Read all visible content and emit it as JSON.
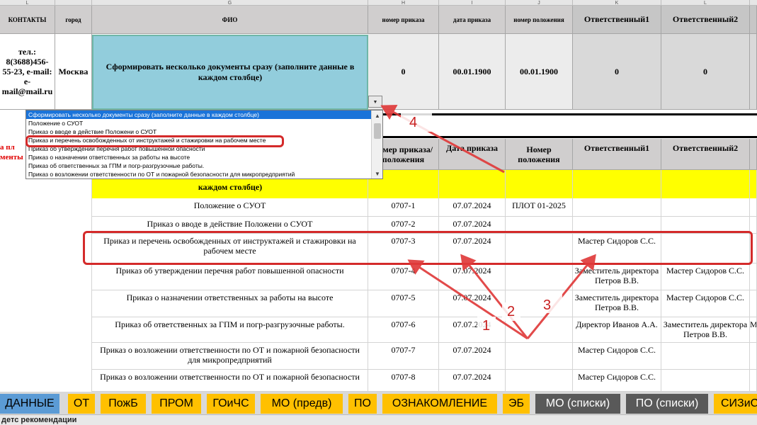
{
  "column_letters": [
    "L",
    "G",
    "H",
    "I",
    "J",
    "K",
    "L"
  ],
  "top_header": {
    "contacts": "КОНТАКТЫ",
    "city": "город",
    "fio": "ФИО",
    "order_number": "номер приказа",
    "order_date": "дата приказа",
    "regulation_number": "номер положения",
    "responsible1": "Ответственный1",
    "responsible2": "Ответственный2"
  },
  "top_row": {
    "contacts": "тел.: 8(3688)456-55-23, e-mail: e-mail@mail.ru",
    "city": "Москва",
    "fio_value": "Сформировать несколько документы сразу (заполните данные в каждом столбце)",
    "order_number": "0",
    "order_date": "00.01.1900",
    "regulation_number": "00.01.1900",
    "responsible1": "0",
    "responsible2": "0"
  },
  "side_text": {
    "line1": "а пл",
    "line2": "менты"
  },
  "dropdown": {
    "items": [
      "Сформировать несколько документы сразу (заполните данные в каждом столбце)",
      "Положение о СУОТ",
      "Приказ о вводе в действие Положени о СУОТ",
      "Приказ и перечень освобожденных от инструктажей и стажировки на рабочем месте",
      "Приказ об утверждении перечня работ повышенной опасности",
      "Приказ о назначении ответственных за работы на высоте",
      "Приказ об ответственных за ГПМ и погр-разгрузочные работы.",
      "Приказ о возложении ответственности по ОТ и пожарной безопасности для микропредприятий"
    ],
    "selected_index": 0,
    "highlighted_index": 3,
    "scroll_up": "▲",
    "scroll_down": "▼",
    "arrow": "▼"
  },
  "lower_header": {
    "order_regulation_number": "номер приказа/ положения",
    "order_date": "Дата приказа",
    "regulation_number": "Номер положения",
    "responsible1": "Ответственный1",
    "responsible2": "Ответственный2"
  },
  "yellow_row_text": "каждом столбце)",
  "rows": [
    {
      "name": "Положение о СУОТ",
      "number": "0707-1",
      "date": "07.07.2024",
      "reg": "ПЛОТ 01-2025",
      "r1": "",
      "r2": "",
      "r3": ""
    },
    {
      "name": "Приказ о вводе в действие Положени о СУОТ",
      "number": "0707-2",
      "date": "07.07.2024",
      "reg": "",
      "r1": "",
      "r2": "",
      "r3": ""
    },
    {
      "name": "Приказ и перечень освобожденных от инструктажей и стажировки на рабочем месте",
      "number": "0707-3",
      "date": "07.07.2024",
      "reg": "",
      "r1": "Мастер Сидоров С.С.",
      "r2": "",
      "r3": ""
    },
    {
      "name": "Приказ об утверждении перечня работ повышенной опасности",
      "number": "0707-4",
      "date": "07.07.2024",
      "reg": "",
      "r1": "Заместитель директора Петров В.В.",
      "r2": "Мастер Сидоров С.С.",
      "r3": ""
    },
    {
      "name": "Приказ о назначении ответственных за работы на высоте",
      "number": "0707-5",
      "date": "07.07.2024",
      "reg": "",
      "r1": "Заместитель директора Петров В.В.",
      "r2": "Мастер Сидоров С.С.",
      "r3": ""
    },
    {
      "name": "Приказ об ответственных за ГПМ и погр-разгрузочные работы.",
      "number": "0707-6",
      "date": "07.07.2024",
      "reg": "",
      "r1": "Директор Иванов А.А.",
      "r2": "Заместитель директора Петров В.В.",
      "r3": "М"
    },
    {
      "name": "Приказ о возложении ответственности по ОТ и пожарной безопасности для микропредприятий",
      "number": "0707-7",
      "date": "07.07.2024",
      "reg": "",
      "r1": "Мастер Сидоров С.С.",
      "r2": "",
      "r3": ""
    },
    {
      "name": "Приказ о возложении ответственности по ОТ и пожарной безопасности",
      "number": "0707-8",
      "date": "07.07.2024",
      "reg": "",
      "r1": "Мастер Сидоров С.С.",
      "r2": "",
      "r3": ""
    }
  ],
  "annotations": [
    "1",
    "2",
    "3",
    "4"
  ],
  "tabs": [
    "ДАННЫЕ",
    "ОТ",
    "ПожБ",
    "ПРОМ",
    "ГОиЧС",
    "МО (предв)",
    "ПО",
    "ОЗНАКОМЛЕНИЕ",
    "ЭБ",
    "МО (списки)",
    "ПО (списки)",
    "СИЗиС"
  ],
  "status_text": "детс рекомендации",
  "colors": {
    "header_gray": "#d0cece",
    "fio_cell": "#92cddc",
    "yellow": "#ffff00",
    "tab_orange": "#ffc000",
    "tab_active": "#5b9bd5",
    "tab_dark": "#595959",
    "highlight_red": "#d42a2a",
    "arrow_red": "#e03b3b"
  }
}
